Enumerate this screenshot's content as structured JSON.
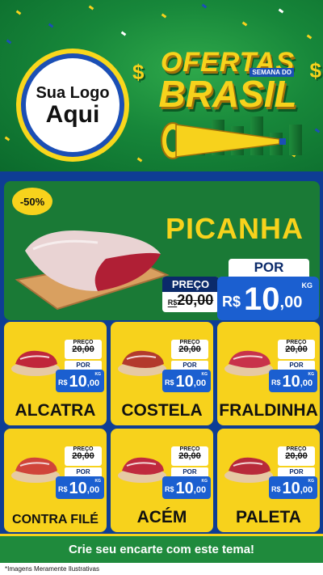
{
  "header": {
    "logo_line1": "Sua Logo",
    "logo_line2": "Aqui",
    "title_top": "OFERTAS",
    "title_small": "SEMANA DO",
    "title_bottom": "BRASIL",
    "dollar": "$"
  },
  "hero": {
    "badge": "-50%",
    "name": "PICANHA",
    "old_label": "PREÇO",
    "old_currency": "R$",
    "old_price": "20,00",
    "por_label": "POR",
    "currency": "R$",
    "price_int": "10",
    "price_dec": ",00",
    "unit": "KG"
  },
  "products": [
    {
      "name": "ALCATRA",
      "old_label": "PREÇO",
      "old_price": "20,00",
      "por_label": "POR",
      "currency": "R$",
      "price_int": "10",
      "price_dec": ",00",
      "unit": "KG"
    },
    {
      "name": "COSTELA",
      "old_label": "PREÇO",
      "old_price": "20,00",
      "por_label": "POR",
      "currency": "R$",
      "price_int": "10",
      "price_dec": ",00",
      "unit": "KG"
    },
    {
      "name": "FRALDINHA",
      "old_label": "PREÇO",
      "old_price": "20,00",
      "por_label": "POR",
      "currency": "R$",
      "price_int": "10",
      "price_dec": ",00",
      "unit": "KG"
    },
    {
      "name": "CONTRA FILÉ",
      "old_label": "PREÇO",
      "old_price": "20,00",
      "por_label": "POR",
      "currency": "R$",
      "price_int": "10",
      "price_dec": ",00",
      "unit": "KG"
    },
    {
      "name": "ACÉM",
      "old_label": "PREÇO",
      "old_price": "20,00",
      "por_label": "POR",
      "currency": "R$",
      "price_int": "10",
      "price_dec": ",00",
      "unit": "KG"
    },
    {
      "name": "PALETA",
      "old_label": "PREÇO",
      "old_price": "20,00",
      "por_label": "POR",
      "currency": "R$",
      "price_int": "10",
      "price_dec": ",00",
      "unit": "KG"
    }
  ],
  "footer": {
    "cta": "Crie seu encarte com este tema!",
    "disclaimer": "*Imagens Meramente Ilustrativas"
  },
  "colors": {
    "green": "#1a7a36",
    "yellow": "#f7d21c",
    "blue": "#0e3d94",
    "price_blue": "#1b5fd0"
  }
}
